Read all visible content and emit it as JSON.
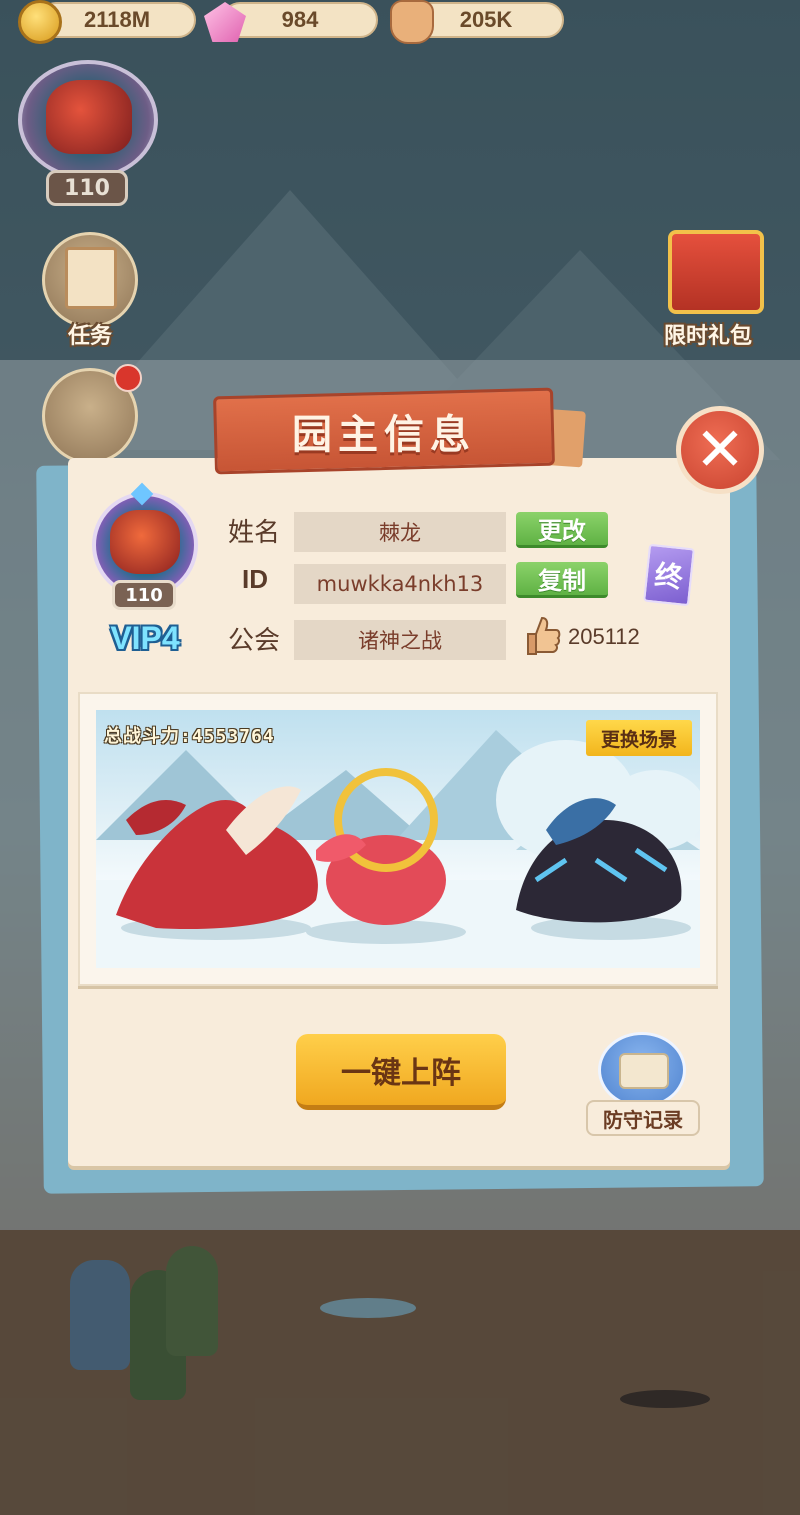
{
  "resources": {
    "gold": "2118M",
    "gems": "984",
    "likes": "205K"
  },
  "player_badge": {
    "level": "110"
  },
  "side_menu": {
    "tasks_label": "任务",
    "gift_label": "限时礼包"
  },
  "modal": {
    "title": "园主信息",
    "avatar_level": "110",
    "vip": "VIP4",
    "name_label": "姓名",
    "name_value": "棘龙",
    "change_button": "更改",
    "id_label": "ID",
    "id_value": "muwkka4nkh13",
    "copy_button": "复制",
    "guild_label": "公会",
    "guild_value": "诸神之战",
    "book_glyph": "终",
    "like_count": "205112",
    "total_power": "总战斗力:4553764",
    "change_scene_button": "更换场景",
    "deploy_button": "一键上阵",
    "defense_record_label": "防守记录"
  },
  "colors": {
    "ribbon": "#d9613f",
    "panel": "#f8ecdb",
    "accent_green": "#6fc150",
    "accent_yellow": "#f5b62a"
  }
}
